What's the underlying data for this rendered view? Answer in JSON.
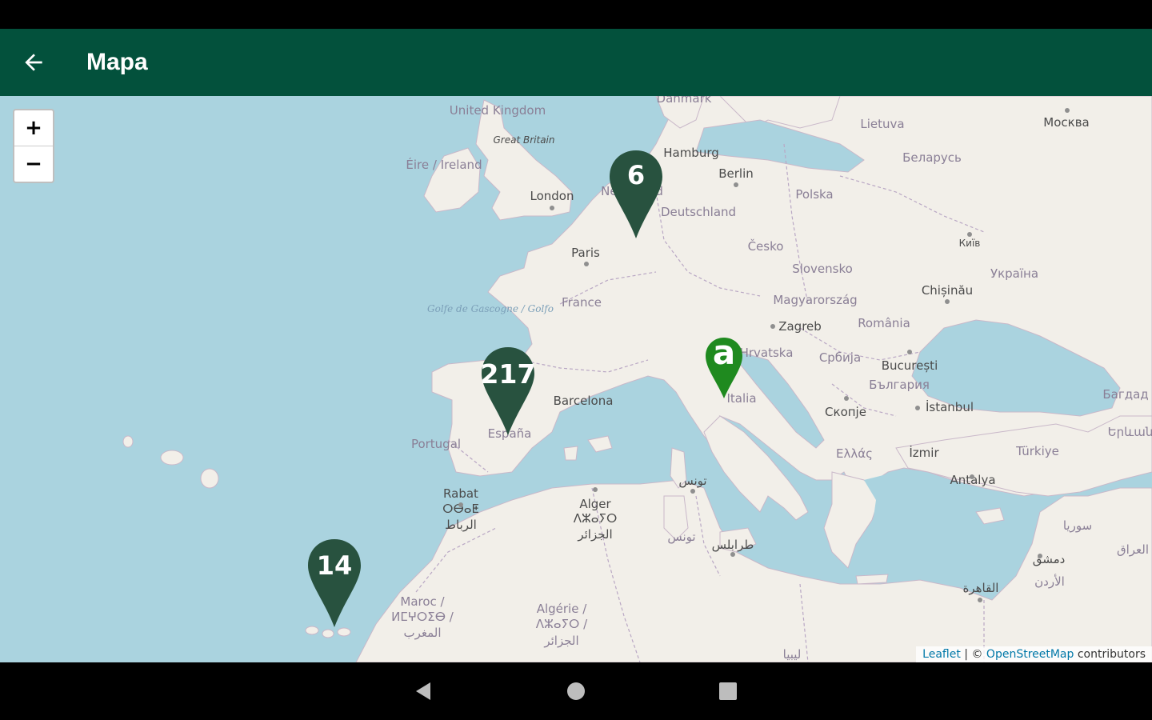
{
  "app_bar": {
    "title": "Mapa"
  },
  "zoom": {
    "in_label": "+",
    "out_label": "−"
  },
  "markers": [
    {
      "label": "6"
    },
    {
      "label": "217"
    },
    {
      "label": "14"
    },
    {
      "label": "a"
    }
  ],
  "attribution": {
    "leaflet": "Leaflet",
    "separator": " | © ",
    "osm": "OpenStreetMap",
    "contributors": " contributors"
  },
  "map_labels": {
    "united_kingdom": "United Kingdom",
    "great_britain": "Great Britain",
    "eire": "Éire / Ireland",
    "london": "London",
    "danmark": "Danmark",
    "hamburg": "Hamburg",
    "berlin": "Berlin",
    "nederland": "Nederland",
    "deutschland": "Deutschland",
    "polska": "Polska",
    "lietuva": "Lietuva",
    "moskva": "Москва",
    "belarus": "Беларусь",
    "kyiv": "Київ",
    "ukraina": "Україна",
    "paris": "Paris",
    "cesko": "Česko",
    "slovensko": "Slovensko",
    "chisinau": "Chișinău",
    "france": "France",
    "golfe": "Golfe de Gascogne / Golfo",
    "magyarorszag": "Magyarország",
    "zagreb": "Zagreb",
    "romania": "România",
    "hrvatska": "Hrvatska",
    "srbija": "Србија",
    "bucuresti": "București",
    "balgariya": "България",
    "barcelona": "Barcelona",
    "italia": "Italia",
    "skopje": "Скопје",
    "istanbul": "İstanbul",
    "portugal": "Portugal",
    "espana": "España",
    "ellada": "Ελλάς",
    "izmir": "İzmir",
    "turkiye": "Türkiye",
    "antalya": "Antalya",
    "rabat": "Rabat",
    "rabat_tifinagh": "ⵔⴱⴰⵟ",
    "rabat_arabic": "الرباط",
    "alger": "Alger",
    "alger_tifinagh": "ⴷⵣⴰⵢⵔ",
    "alger_arabic": "الجزائر",
    "tunis_arabic": "تونس",
    "tunisie_arabic": "تونس",
    "tripoli_arabic": "طرابلس",
    "maroc": "Maroc /",
    "maroc_tifinagh": "ⵍⵎⵖⵔⵉⴱ /",
    "maroc_arabic": "المغرب",
    "algerie": "Algérie /",
    "algerie_tifinagh": "ⴷⵣⴰⵢⵔ /",
    "algerie_arabic": "الجزائر",
    "libya_arabic": "ليبيا",
    "cairo_arabic": "القاهرة",
    "syria_arabic": "سوريا",
    "damascus_arabic": "دمشق",
    "jordan_arabic": "الأردن",
    "iraq_arabic": "العراق",
    "bagdad": "Багдад",
    "yerevan": "Երևան"
  }
}
